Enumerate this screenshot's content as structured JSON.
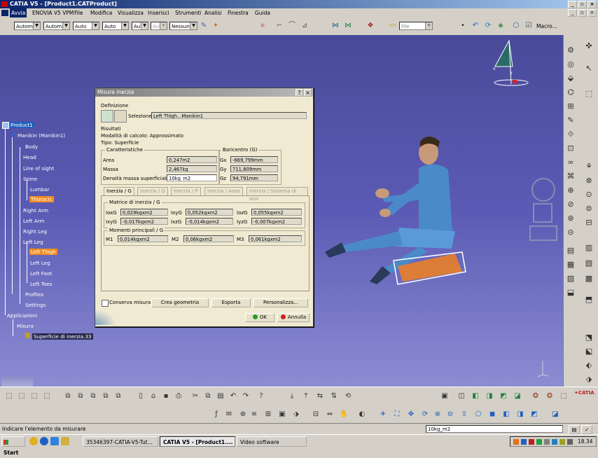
{
  "window": {
    "title": "CATIA V5 - [Product1.CATProduct]"
  },
  "menu": [
    "Avvia",
    "ENOVIA V5 VPM",
    "File",
    "Modifica",
    "Visualizza",
    "Inserisci",
    "Strumenti",
    "Analisi",
    "Finestra",
    "Guida"
  ],
  "toolbar1": {
    "combos": [
      "Autome",
      "Automa",
      "Auto",
      "Auto",
      "Aut",
      "Aut",
      "Nessuno"
    ],
    "file_combo": "File",
    "macro_label": "Macro..."
  },
  "tree": {
    "root": "Product1",
    "manikin": "Manikin (Manikin1)",
    "body": "Body",
    "head": "Head",
    "line_of_sight": "Line of sight",
    "spine": "Spine",
    "lumbar": "Lumbar",
    "thoracic": "Thoracic",
    "right_arm": "Right Arm",
    "left_arm": "Left Arm",
    "right_leg": "Right Leg",
    "left_leg": "Left Leg",
    "left_thigh": "Left Thigh",
    "left_leg2": "Left Leg",
    "left_foot": "Left Foot",
    "left_toes": "Left Toes",
    "profiles": "Profiles",
    "settings": "Settings",
    "applicazioni": "Applicazioni",
    "misura": "Misura",
    "superficie": "Superficie di inerzia.33"
  },
  "dialog": {
    "title": "Misura inerzia",
    "help": "?",
    "close": "×",
    "definizione": "Definizione",
    "selezione_label": "Selezione:",
    "selezione_value": "Left Thigh...Manikin1",
    "risultati": "Risultati",
    "modalita": "Modalità di calcolo:  Approssimato",
    "tipo": "Tipo:  Superficie",
    "caratteristiche": "Caratteristiche",
    "area_label": "Area",
    "area_value": "0,247m2",
    "massa_label": "Massa",
    "massa_value": "2,467kg",
    "densita_label": "Densità massa superficiale",
    "densita_value": "10kg_m2",
    "baricentro": "Baricentro (G)",
    "gx_label": "Gx",
    "gx_value": "-669,799mm",
    "gy_label": "Gy",
    "gy_value": "711,809mm",
    "gz_label": "Gz",
    "gz_value": "94,791mm",
    "tabs": [
      "Inerzia / G",
      "Inerzia / O",
      "Inerzia / P",
      "Inerzia / Asse",
      "Inerzia / Sistema di assi"
    ],
    "matrice": "Matrice di inerzia / G",
    "ioxg_label": "IoxG",
    "ioxg_value": "0,029kgxm2",
    "ioyg_label": "IoyG",
    "ioyg_value": "0,052kgxm2",
    "iozg_label": "IozG",
    "iozg_value": "0,055kgxm2",
    "ixyg_label": "IxyG",
    "ixyg_value": "-0,017kgxm2",
    "ixzg_label": "IxzG",
    "ixzg_value": "-0,014kgxm2",
    "iyzg_label": "IyzG",
    "iyzg_value": "-0,007kgxm2",
    "momenti": "Momenti principali / G",
    "m1_label": "M1",
    "m1_value": "0,014kgxm2",
    "m2_label": "M2",
    "m2_value": "0,06kgxm2",
    "m3_label": "M3",
    "m3_value": "0,061kgxm2",
    "conserva": "Conserva misura",
    "crea": "Crea geometria",
    "esporta": "Esporta",
    "personalizza": "Personalizza...",
    "ok": "OK",
    "annulla": "Annulla"
  },
  "status": {
    "message": "Indicare l'elemento da misurare",
    "input": "10kg_m2"
  },
  "taskbar": {
    "start": "Start",
    "items": [
      "35346397-CATIA-V5-Tut...",
      "CATIA V5 - [Product1....",
      "Video software"
    ],
    "clock": "18.34"
  },
  "colors": {
    "viewport_top": "#4a4a9a",
    "selection_orange": "#f08c1e",
    "dialog_bg": "#f0ead2"
  }
}
